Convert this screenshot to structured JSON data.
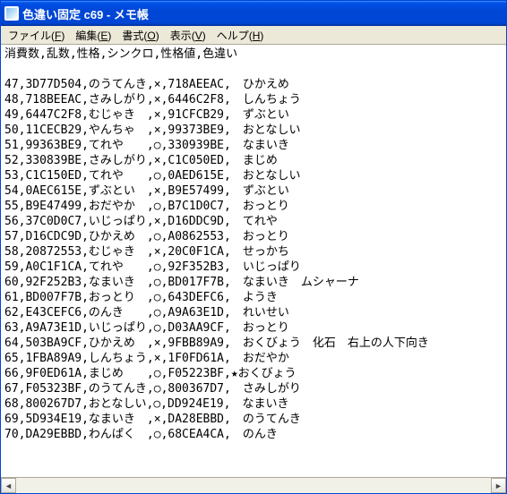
{
  "window": {
    "title": "色違い固定 c69 - メモ帳"
  },
  "menu": {
    "file": {
      "label": "ファイル",
      "key": "F"
    },
    "edit": {
      "label": "編集",
      "key": "E"
    },
    "format": {
      "label": "書式",
      "key": "O"
    },
    "view": {
      "label": "表示",
      "key": "V"
    },
    "help": {
      "label": "ヘルプ",
      "key": "H"
    }
  },
  "header": "消費数,乱数,性格,シンクロ,性格値,色違い",
  "rows": [
    {
      "n": "47",
      "r": "3D77D504",
      "nat": "のうてんき",
      "s": "×",
      "pid": "718AEEAC",
      "sh": "　",
      "res": "ひかえめ"
    },
    {
      "n": "48",
      "r": "718BEEAC",
      "nat": "さみしがり",
      "s": "×",
      "pid": "6446C2F8",
      "sh": "　",
      "res": "しんちょう"
    },
    {
      "n": "49",
      "r": "6447C2F8",
      "nat": "むじゃき　",
      "s": "×",
      "pid": "91CFCB29",
      "sh": "　",
      "res": "ずぶとい"
    },
    {
      "n": "50",
      "r": "11CECB29",
      "nat": "やんちゃ　",
      "s": "×",
      "pid": "99373BE9",
      "sh": "　",
      "res": "おとなしい"
    },
    {
      "n": "51",
      "r": "99363BE9",
      "nat": "てれや　　",
      "s": "○",
      "pid": "330939BE",
      "sh": "　",
      "res": "なまいき"
    },
    {
      "n": "52",
      "r": "330839BE",
      "nat": "さみしがり",
      "s": "×",
      "pid": "C1C050ED",
      "sh": "　",
      "res": "まじめ"
    },
    {
      "n": "53",
      "r": "C1C150ED",
      "nat": "てれや　　",
      "s": "○",
      "pid": "0AED615E",
      "sh": "　",
      "res": "おとなしい"
    },
    {
      "n": "54",
      "r": "0AEC615E",
      "nat": "ずぶとい　",
      "s": "×",
      "pid": "B9E57499",
      "sh": "　",
      "res": "ずぶとい"
    },
    {
      "n": "55",
      "r": "B9E47499",
      "nat": "おだやか　",
      "s": "○",
      "pid": "B7C1D0C7",
      "sh": "　",
      "res": "おっとり"
    },
    {
      "n": "56",
      "r": "37C0D0C7",
      "nat": "いじっぱり",
      "s": "×",
      "pid": "D16DDC9D",
      "sh": "　",
      "res": "てれや"
    },
    {
      "n": "57",
      "r": "D16CDC9D",
      "nat": "ひかえめ　",
      "s": "○",
      "pid": "A0862553",
      "sh": "　",
      "res": "おっとり"
    },
    {
      "n": "58",
      "r": "20872553",
      "nat": "むじゃき　",
      "s": "×",
      "pid": "20C0F1CA",
      "sh": "　",
      "res": "せっかち"
    },
    {
      "n": "59",
      "r": "A0C1F1CA",
      "nat": "てれや　　",
      "s": "○",
      "pid": "92F352B3",
      "sh": "　",
      "res": "いじっぱり"
    },
    {
      "n": "60",
      "r": "92F252B3",
      "nat": "なまいき　",
      "s": "○",
      "pid": "BD017F7B",
      "sh": "　",
      "res": "なまいき　ムシャーナ"
    },
    {
      "n": "61",
      "r": "BD007F7B",
      "nat": "おっとり　",
      "s": "○",
      "pid": "643DEFC6",
      "sh": "　",
      "res": "ようき"
    },
    {
      "n": "62",
      "r": "E43CEFC6",
      "nat": "のんき　　",
      "s": "○",
      "pid": "A9A63E1D",
      "sh": "　",
      "res": "れいせい"
    },
    {
      "n": "63",
      "r": "A9A73E1D",
      "nat": "いじっぱり",
      "s": "○",
      "pid": "D03AA9CF",
      "sh": "　",
      "res": "おっとり"
    },
    {
      "n": "64",
      "r": "503BA9CF",
      "nat": "ひかえめ　",
      "s": "×",
      "pid": "9FBB89A9",
      "sh": "　",
      "res": "おくびょう　化石　右上の人下向き"
    },
    {
      "n": "65",
      "r": "1FBA89A9",
      "nat": "しんちょう",
      "s": "×",
      "pid": "1F0FD61A",
      "sh": "　",
      "res": "おだやか"
    },
    {
      "n": "66",
      "r": "9F0ED61A",
      "nat": "まじめ　　",
      "s": "○",
      "pid": "F05223BF",
      "sh": "★",
      "res": "おくびょう"
    },
    {
      "n": "67",
      "r": "F05323BF",
      "nat": "のうてんき",
      "s": "○",
      "pid": "800367D7",
      "sh": "　",
      "res": "さみしがり"
    },
    {
      "n": "68",
      "r": "800267D7",
      "nat": "おとなしい",
      "s": "○",
      "pid": "DD924E19",
      "sh": "　",
      "res": "なまいき"
    },
    {
      "n": "69",
      "r": "5D934E19",
      "nat": "なまいき　",
      "s": "×",
      "pid": "DA28EBBD",
      "sh": "　",
      "res": "のうてんき"
    },
    {
      "n": "70",
      "r": "DA29EBBD",
      "nat": "わんぱく　",
      "s": "○",
      "pid": "68CEA4CA",
      "sh": "　",
      "res": "のんき"
    }
  ]
}
